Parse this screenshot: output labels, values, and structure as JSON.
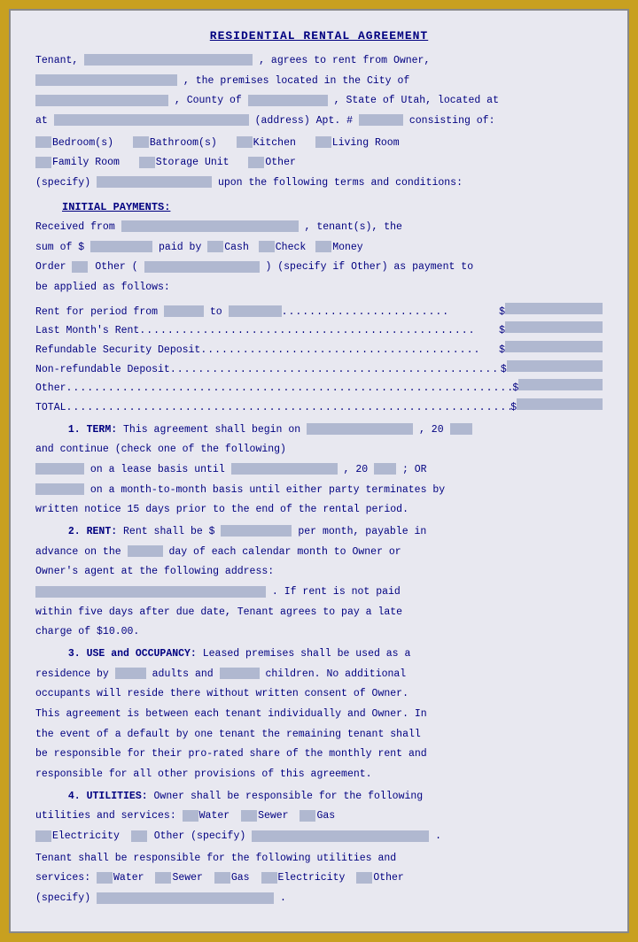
{
  "title": "RESIDENTIAL RENTAL AGREEMENT",
  "sections": {
    "tenant_line": "Tenant,",
    "agrees": ", agrees to rent from Owner,",
    "premises": ", the premises located in the City of",
    "county": ", County of",
    "state": ", State of Utah, located at",
    "address_label": "(address) Apt. #",
    "consisting": "consisting of:",
    "bedrooms": "Bedroom(s)",
    "bathrooms": "Bathroom(s)",
    "kitchen": "Kitchen",
    "living_room": "Living Room",
    "family_room": "Family Room",
    "storage": "Storage Unit",
    "other": "Other",
    "specify_other": "(specify)",
    "following_terms": "upon the following terms and conditions:",
    "initial_payments": "INITIAL PAYMENTS:",
    "received_from": "Received from",
    "tenants": ", tenant(s), the",
    "sum_of": "sum of $",
    "paid_by": "paid by",
    "cash": "Cash",
    "check": "Check",
    "money_order": "Money",
    "order": "Order",
    "other2": "Other (",
    "specify_if_other": ") (specify if Other) as payment to",
    "be_applied": "be applied as follows:",
    "rent_period_from": "Rent for period from",
    "to": "to",
    "last_months_rent": "Last Month's Rent",
    "refundable_security": "Refundable Security Deposit",
    "non_refundable": "Non-refundable Deposit",
    "other_line": "Other",
    "total": "TOTAL",
    "term_heading": "1. TERM:",
    "term_text": "This agreement shall begin on",
    "term_year": ", 20",
    "continue": "and continue (check one of the following)",
    "lease_basis": "on a lease basis until",
    "lease_year": ", 20",
    "or_text": "; OR",
    "month_to_month": "on a month-to-month basis until either party terminates by",
    "written_notice": "written notice 15 days prior to the end of the rental period.",
    "rent_heading": "2. RENT:",
    "rent_text": "Rent shall be $",
    "per_month": "per month, payable in",
    "advance_on": "advance on the",
    "day_of": "day of each calendar month to Owner or",
    "owners_agent": "Owner's agent at the following address:",
    "if_rent": ". If rent is not paid",
    "within_five": "within five days after due date, Tenant agrees to pay a late",
    "charge": "charge of $10.00.",
    "use_heading": "3. USE and OCCUPANCY:",
    "use_text": "Leased premises shall be used as a",
    "residence": "residence by",
    "adults": "adults and",
    "children": "children. No additional",
    "occupants": "occupants will reside there without written consent of Owner.",
    "agreement_between": "This agreement is between each tenant individually and Owner.  In",
    "event_default": "the event of a default by one tenant the remaining tenant shall",
    "responsible_prorated": "be responsible for their pro-rated share of the monthly rent and",
    "responsible_all": "responsible for all other provisions of this agreement.",
    "utilities_heading": "4. UTILITIES:",
    "utilities_text": "Owner shall be responsible for the following",
    "utilities_services": "utilities and services:",
    "water1": "Water",
    "sewer1": "Sewer",
    "gas1": "Gas",
    "electricity1": "Electricity",
    "other_utilities1": "Other (specify)",
    "tenant_responsible": "Tenant shall be responsible for the following utilities and",
    "services2": "services:",
    "water2": "Water",
    "sewer2": "Sewer",
    "gas2": "Gas",
    "electricity2": "Electricity",
    "other2_label": "Other",
    "specify2": "(specify)"
  }
}
